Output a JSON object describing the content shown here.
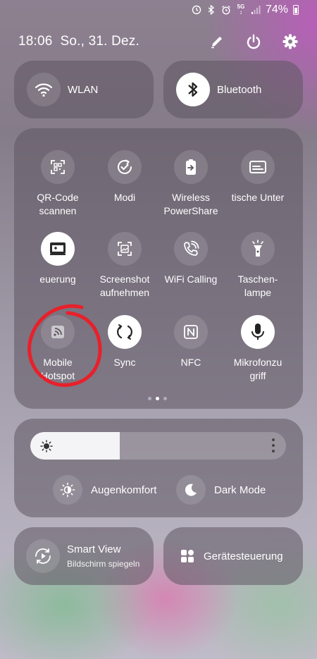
{
  "status_bar": {
    "battery_percent": "74%",
    "network": "5G",
    "icons": [
      "clock-alarm-icon",
      "bluetooth-icon",
      "alarm-icon",
      "5g-icon",
      "signal-icon",
      "battery-icon"
    ]
  },
  "header": {
    "datetime": "18:06  So., 31. Dez.",
    "icons": [
      "pencil-icon",
      "power-icon",
      "gear-icon"
    ]
  },
  "top_tiles": [
    {
      "label": "WLAN",
      "icon": "wifi-icon",
      "active": false
    },
    {
      "label": "Bluetooth",
      "icon": "bluetooth-icon",
      "active": true
    }
  ],
  "quick_tiles": [
    {
      "label": "QR-Code\nscannen",
      "icon": "qr-scan-icon",
      "active": false
    },
    {
      "label": "Modi",
      "icon": "modes-check-icon",
      "active": false
    },
    {
      "label": "Wireless\nPowerShare",
      "icon": "powershare-icon",
      "active": false
    },
    {
      "label": "tische Unter",
      "icon": "live-caption-icon",
      "active": false
    },
    {
      "label": "euerung",
      "icon": "device-control-icon",
      "active": true
    },
    {
      "label": "Screenshot\naufnehmen",
      "icon": "screenshot-icon",
      "active": false
    },
    {
      "label": "WiFi Calling",
      "icon": "wifi-calling-icon",
      "active": false
    },
    {
      "label": "Taschen-\nlampe",
      "icon": "flashlight-icon",
      "active": false
    },
    {
      "label": "Mobile\nHotspot",
      "icon": "hotspot-icon",
      "active": false
    },
    {
      "label": "Sync",
      "icon": "sync-icon",
      "active": true
    },
    {
      "label": "NFC",
      "icon": "nfc-icon",
      "active": false
    },
    {
      "label": "Mikrofonzu\ngriff",
      "icon": "microphone-icon",
      "active": true
    }
  ],
  "page_indicator": {
    "pages": 3,
    "current": 2
  },
  "brightness": {
    "level": 0.35
  },
  "modes": [
    {
      "label": "Augenkomfort",
      "icon": "eye-comfort-icon"
    },
    {
      "label": "Dark Mode",
      "icon": "moon-icon"
    }
  ],
  "bottom_tiles": [
    {
      "title": "Smart View",
      "subtitle": "Bildschirm spiegeln",
      "icon": "smart-view-icon"
    },
    {
      "title": "Gerätesteuerung",
      "icon": "device-grid-icon"
    }
  ],
  "colors": {
    "annotation": "#e8202a",
    "tile_on": "#ffffff"
  }
}
